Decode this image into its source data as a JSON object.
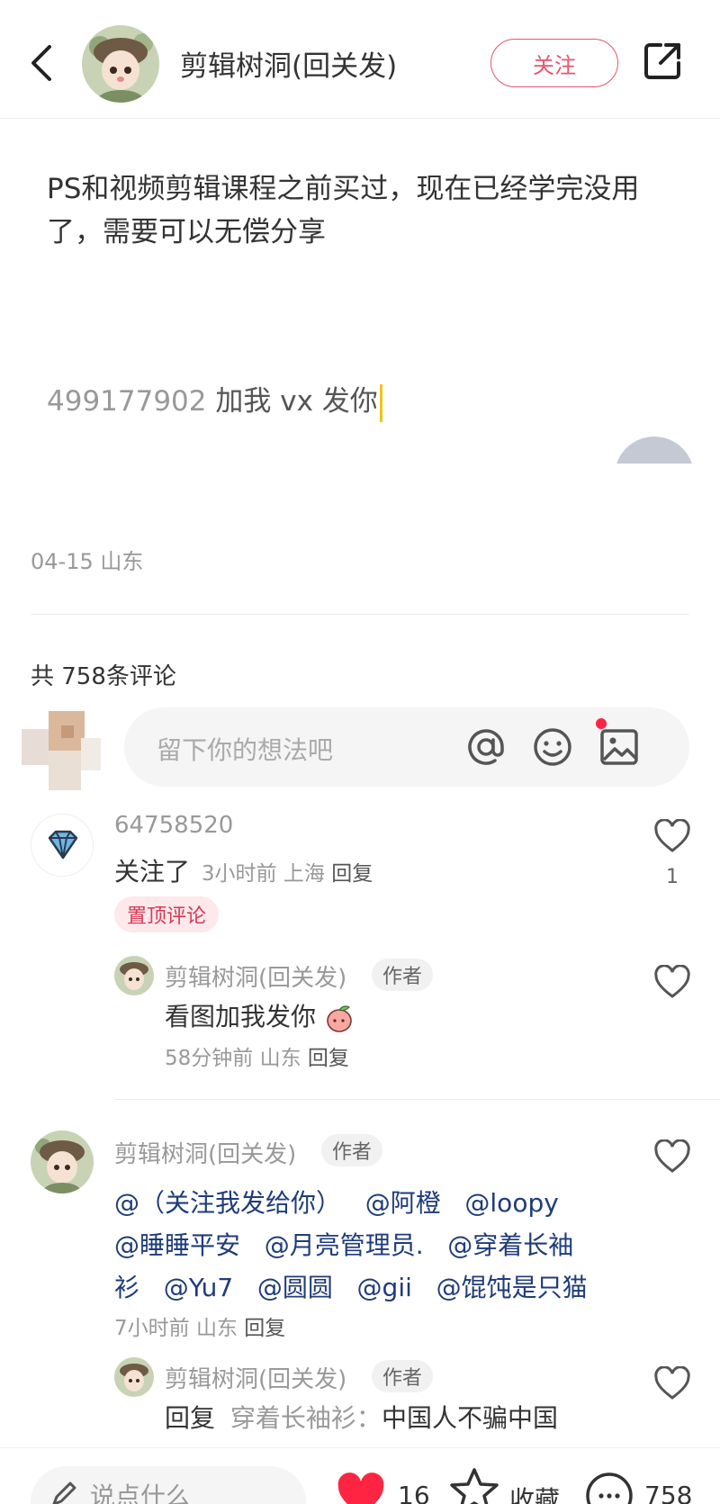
{
  "header": {
    "author_name": "剪辑树洞(回关发)",
    "follow_label": "关注"
  },
  "post": {
    "body": "PS和视频剪辑课程之前买过，现在已经学完没用了，需要可以无偿分享",
    "contact_number": "499177902",
    "contact_text": "加我 vx 发你",
    "date": "04-15",
    "location": "山东"
  },
  "comments_section": {
    "count_label": "共 758条评论",
    "input_placeholder": "留下你的想法吧"
  },
  "comments": [
    {
      "name": "64758520",
      "text": "关注了",
      "time": "3小时前",
      "location": "上海",
      "reply_label": "回复",
      "pin_label": "置顶评论",
      "likes": "1",
      "avatar_icon": "diamond-icon",
      "reply": {
        "name": "剪辑树洞(回关发)",
        "badge": "作者",
        "text": "看图加我发你",
        "time": "58分钟前",
        "location": "山东",
        "reply_label": "回复"
      }
    },
    {
      "name": "剪辑树洞(回关发)",
      "badge": "作者",
      "line1": "@（关注我发给你）   @阿橙   @loopy",
      "line2": "@睡睡平安   @月亮管理员.   @穿着长袖",
      "line3": "衫   @Yu7   @圆圆   @gii   @馄饨是只猫",
      "time": "7小时前",
      "location": "山东",
      "reply_label": "回复",
      "reply": {
        "name": "剪辑树洞(回关发)",
        "badge": "作者",
        "prefix": "回复",
        "target": "穿着长袖衫：",
        "text": "中国人不骗中国"
      }
    }
  ],
  "bottom_bar": {
    "say_placeholder": "说点什么",
    "like_count": "16",
    "favorite_label": "收藏",
    "comment_count": "758"
  },
  "colors": {
    "accent": "#e9546b",
    "heart": "#ff2442",
    "mention": "#1f3c7a"
  }
}
